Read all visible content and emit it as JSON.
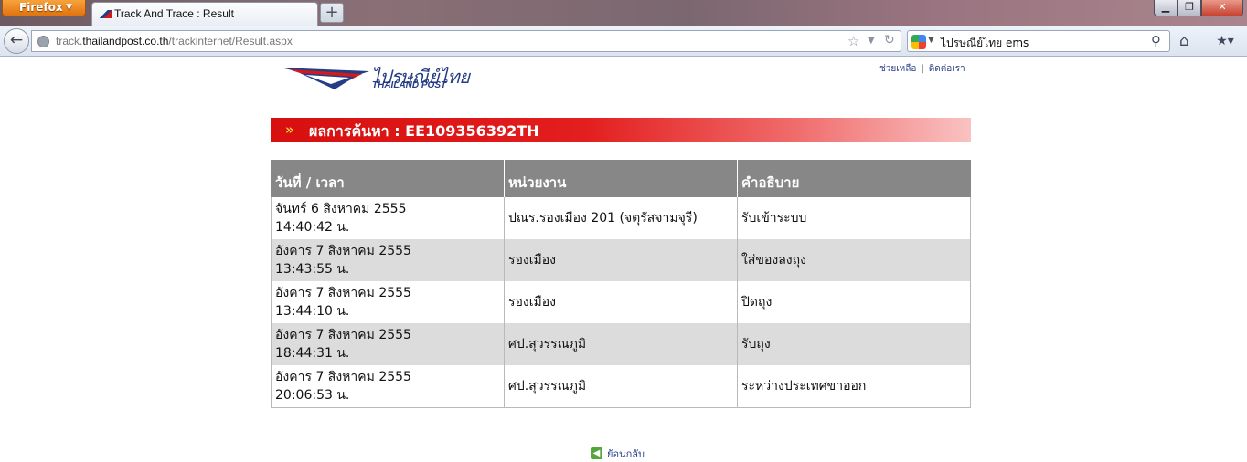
{
  "browser": {
    "menu_button": "Firefox",
    "tab_title": "Track And Trace : Result",
    "new_tab": "+",
    "url_prefix": "track.",
    "url_domain": "thailandpost.co.th",
    "url_path": "/trackinternet/Result.aspx",
    "search_value": "ไปรษณีย์ไทย ems",
    "icons": [
      "back-arrow-icon",
      "globe-icon",
      "star-icon",
      "reload-icon",
      "google-icon",
      "search-icon",
      "home-icon",
      "bookmarks-icon"
    ]
  },
  "page": {
    "logo_thai": "ไปรษณีย์ไทย",
    "logo_english": "THAILAND POST",
    "help_link": "ช่วยเหลือ",
    "contact_link": "ติดต่อเรา",
    "result_title": "ผลการค้นหา : EE109356392TH",
    "table": {
      "headers": [
        "วันที่ / เวลา",
        "หน่วยงาน",
        "คำอธิบาย"
      ],
      "rows": [
        {
          "date": "จันทร์ 6 สิงหาคม 2555",
          "time": "14:40:42 น.",
          "office": "ปณร.รองเมือง 201 (จตุรัสจามจุรี)",
          "description": "รับเข้าระบบ"
        },
        {
          "date": "อังคาร 7 สิงหาคม 2555",
          "time": "13:43:55 น.",
          "office": "รองเมือง",
          "description": "ใส่ของลงถุง"
        },
        {
          "date": "อังคาร 7 สิงหาคม 2555",
          "time": "13:44:10 น.",
          "office": "รองเมือง",
          "description": "ปิดถุง"
        },
        {
          "date": "อังคาร 7 สิงหาคม 2555",
          "time": "18:44:31 น.",
          "office": "ศป.สุวรรณภูมิ",
          "description": "รับถุง"
        },
        {
          "date": "อังคาร 7 สิงหาคม 2555",
          "time": "20:06:53 น.",
          "office": "ศป.สุวรรณภูมิ",
          "description": "ระหว่างประเทศขาออก"
        }
      ]
    },
    "back_link": "ย้อนกลับ",
    "colors": {
      "brand_blue": "#243d86",
      "banner_red": "#d70f0f",
      "header_gray": "#878787",
      "row_alt": "#dcdcdc"
    }
  }
}
